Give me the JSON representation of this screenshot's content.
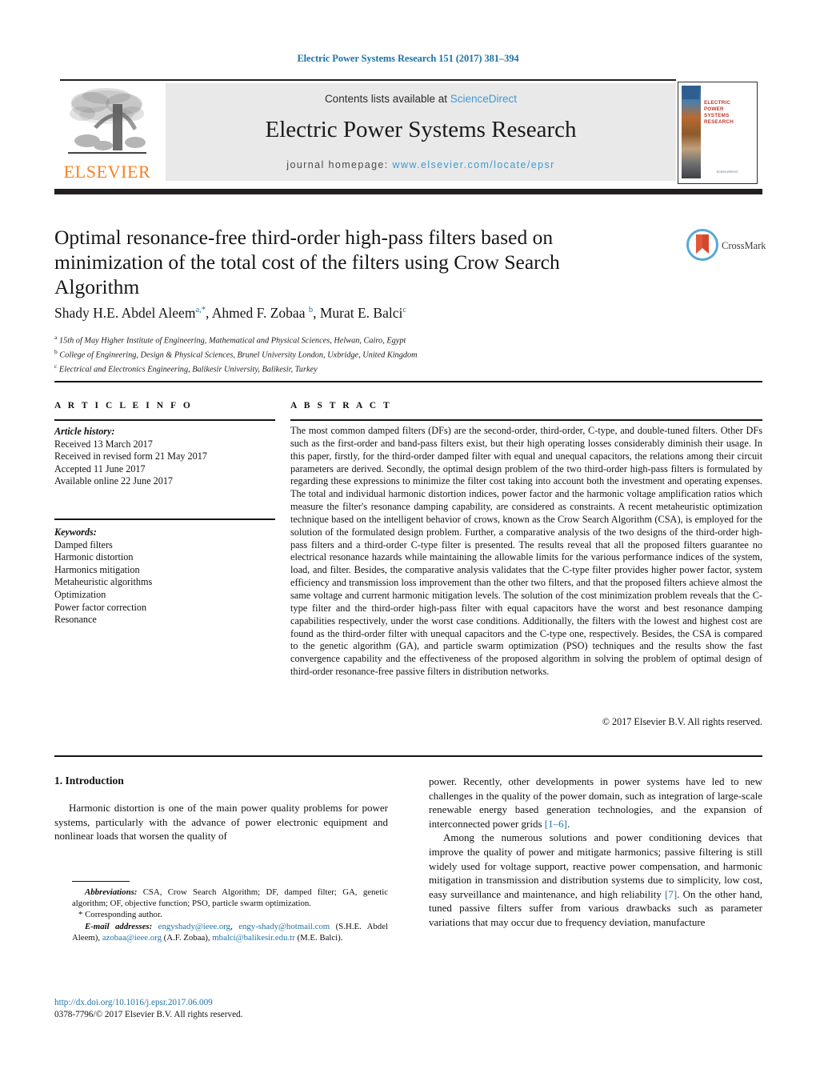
{
  "running_head": "Electric Power Systems Research 151 (2017) 381–394",
  "masthead": {
    "contents_prefix": "Contents lists available at ",
    "contents_link": "ScienceDirect",
    "journal_title": "Electric Power Systems Research",
    "homepage_prefix": "journal homepage: ",
    "homepage_link": "www.elsevier.com/locate/epsr",
    "publisher_wordmark": "ELSEVIER",
    "cover_title": "ELECTRIC POWER SYSTEMS RESEARCH",
    "cover_footer": "ScienceDirect",
    "accent_orange": "#f58220",
    "link_blue": "#3d9ad1"
  },
  "crossmark": {
    "label": "CrossMark"
  },
  "article": {
    "title": "Optimal resonance-free third-order high-pass filters based on minimization of the total cost of the filters using Crow Search Algorithm",
    "authors_html": "Shady H.E. Abdel Aleem<sup>a,*</sup>, Ahmed F. Zobaa <sup>b</sup>, Murat E. Balci<sup>c</sup>",
    "affiliations": [
      {
        "marker": "a",
        "text": "15th of May Higher Institute of Engineering, Mathematical and Physical Sciences, Helwan, Cairo, Egypt"
      },
      {
        "marker": "b",
        "text": "College of Engineering, Design & Physical Sciences, Brunel University London, Uxbridge, United Kingdom"
      },
      {
        "marker": "c",
        "text": "Electrical and Electronics Engineering, Balikesir University, Balikesir, Turkey"
      }
    ]
  },
  "article_info": {
    "heading": "A R T I C L E   I N F O",
    "history_label": "Article history:",
    "history": [
      "Received 13 March 2017",
      "Received in revised form 21 May 2017",
      "Accepted 11 June 2017",
      "Available online 22 June 2017"
    ],
    "keywords_label": "Keywords:",
    "keywords": [
      "Damped filters",
      "Harmonic distortion",
      "Harmonics mitigation",
      "Metaheuristic algorithms",
      "Optimization",
      "Power factor correction",
      "Resonance"
    ]
  },
  "abstract": {
    "heading": "A B S T R A C T",
    "text": "The most common damped filters (DFs) are the second-order, third-order, C-type, and double-tuned filters. Other DFs such as the first-order and band-pass filters exist, but their high operating losses considerably diminish their usage. In this paper, firstly, for the third-order damped filter with equal and unequal capacitors, the relations among their circuit parameters are derived. Secondly, the optimal design problem of the two third-order high-pass filters is formulated by regarding these expressions to minimize the filter cost taking into account both the investment and operating expenses. The total and individual harmonic distortion indices, power factor and the harmonic voltage amplification ratios which measure the filter's resonance damping capability, are considered as constraints. A recent metaheuristic optimization technique based on the intelligent behavior of crows, known as the Crow Search Algorithm (CSA), is employed for the solution of the formulated design problem. Further, a comparative analysis of the two designs of the third-order high-pass filters and a third-order C-type filter is presented. The results reveal that all the proposed filters guarantee no electrical resonance hazards while maintaining the allowable limits for the various performance indices of the system, load, and filter. Besides, the comparative analysis validates that the C-type filter provides higher power factor, system efficiency and transmission loss improvement than the other two filters, and that the proposed filters achieve almost the same voltage and current harmonic mitigation levels. The solution of the cost minimization problem reveals that the C-type filter and the third-order high-pass filter with equal capacitors have the worst and best resonance damping capabilities respectively, under the worst case conditions. Additionally, the filters with the lowest and highest cost are found as the third-order filter with unequal capacitors and the C-type one, respectively. Besides, the CSA is compared to the genetic algorithm (GA), and particle swarm optimization (PSO) techniques and the results show the fast convergence capability and the effectiveness of the proposed algorithm in solving the problem of optimal design of third-order resonance-free passive filters in distribution networks.",
    "copyright": "© 2017 Elsevier B.V. All rights reserved."
  },
  "body": {
    "section_number_title": "1.  Introduction",
    "left_para_1": "Harmonic distortion is one of the main power quality problems for power systems, particularly with the advance of power electronic equipment and nonlinear loads that worsen the quality of",
    "right_para_1_a": "power. Recently, other developments in power systems have led to new challenges in the quality of the power domain, such as integration of large-scale renewable energy based generation technologies, and the expansion of interconnected power grids ",
    "right_para_1_ref": "[1–6]",
    "right_para_1_b": ".",
    "right_para_2_a": "Among the numerous solutions and power conditioning devices that improve the quality of power and mitigate harmonics; passive filtering is still widely used for voltage support, reactive power compensation, and harmonic mitigation in transmission and distribution systems due to simplicity, low cost, easy surveillance and maintenance, and high reliability ",
    "right_para_2_ref": "[7]",
    "right_para_2_b": ". On the other hand, tuned passive filters suffer from various drawbacks such as parameter variations that may occur due to frequency deviation, manufacture"
  },
  "footnotes": {
    "abbrev_label": "Abbreviations:",
    "abbrev_text": " CSA, Crow Search Algorithm; DF, damped filter; GA, genetic algorithm; OF, objective function; PSO, particle swarm optimization.",
    "corresponding": "* Corresponding author.",
    "email_label": "E-mail addresses:",
    "email_1": "engyshady@ieee.org",
    "email_2": "engy-shady@hotmail.com",
    "email_1_owner": "(S.H.E. Abdel Aleem), ",
    "email_3": "azobaa@ieee.org",
    "email_3_owner": " (A.F. Zobaa), ",
    "email_4": "mbalci@balikesir.edu.tr",
    "email_4_owner": "(M.E. Balci).",
    "doi": "http://dx.doi.org/10.1016/j.epsr.2017.06.009",
    "issn_line": "0378-7796/© 2017 Elsevier B.V. All rights reserved."
  }
}
